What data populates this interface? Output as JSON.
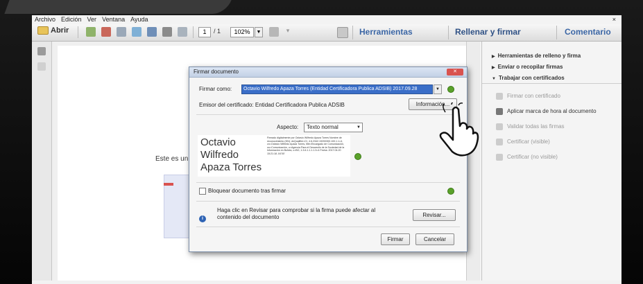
{
  "menu": {
    "items": [
      "Archivo",
      "Edición",
      "Ver",
      "Ventana",
      "Ayuda"
    ],
    "close": "×"
  },
  "toolbar": {
    "open_label": "Abrir",
    "page_current": "1",
    "page_total": "/ 1",
    "zoom": "102%",
    "herramientas": "Herramientas",
    "rellenar": "Rellenar y firmar",
    "comentario": "Comentario"
  },
  "document": {
    "text": "Este es un d"
  },
  "right_panel": {
    "sections": [
      {
        "label": "Herramientas de relleno y firma",
        "expanded": false
      },
      {
        "label": "Enviar o recopilar firmas",
        "expanded": false
      },
      {
        "label": "Trabajar con certificados",
        "expanded": true
      }
    ],
    "actions": [
      {
        "label": "Firmar con certificado",
        "enabled": false
      },
      {
        "label": "Aplicar marca de hora al documento",
        "enabled": true
      },
      {
        "label": "Validar todas las firmas",
        "enabled": false
      },
      {
        "label": "Certificar (visible)",
        "enabled": false
      },
      {
        "label": "Certificar (no visible)",
        "enabled": false
      }
    ]
  },
  "dialog": {
    "title": "Firmar documento",
    "sign_as_label": "Firmar como:",
    "sign_as_value": "Octavio Wilfredo Apaza Torres (Entidad Certificadora Publica ADSIB) 2017.09.28",
    "issuer": "Emisor del certificado: Entidad Certificadora Publica ADSIB",
    "info_button": "Información...",
    "aspect_label": "Aspecto:",
    "aspect_value": "Texto normal",
    "signature_name": [
      "Octavio",
      "Wilfredo",
      "Apaza Torres"
    ],
    "signature_detail": "Firmado digitalmente por Octavio Wilfredo Apaza Torres Nombre de reconocimiento (DN): dnQualifier=CI, 4.6.2342.19200300.100.1.1=4, cn=Octavio Wilfredo Apaza Torres, title=Encargado de Comunicación, ou=Comunicación, o=Agencia Para el Desarrollo de la Sociedad de la Información en Bolivia, c=BO, 1.3.6.1.1.1.1.3=4 Fecha: 2017.04.20 15:21:18 -04'00'",
    "lock_label": "Bloquear documento tras firmar",
    "review_text": "Haga clic en Revisar para comprobar si la firma puede afectar al contenido del documento",
    "review_button": "Revisar...",
    "sign_button": "Firmar",
    "cancel_button": "Cancelar"
  }
}
